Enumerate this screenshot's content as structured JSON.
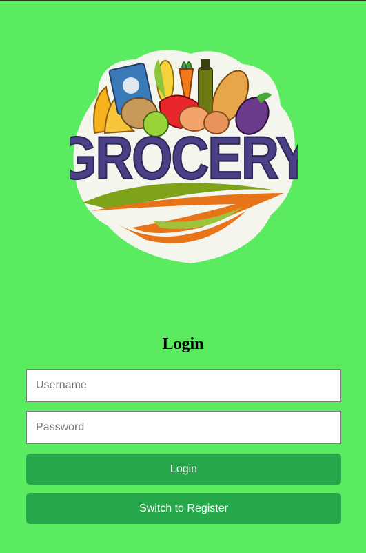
{
  "logo": {
    "text": "GROCERY",
    "icon": "grocery-bag-logo"
  },
  "form": {
    "title": "Login",
    "username_placeholder": "Username",
    "password_placeholder": "Password",
    "login_label": "Login",
    "switch_label": "Switch to Register"
  },
  "colors": {
    "background": "#5aeb60",
    "button": "#26a749",
    "button_text": "#ffffff"
  }
}
